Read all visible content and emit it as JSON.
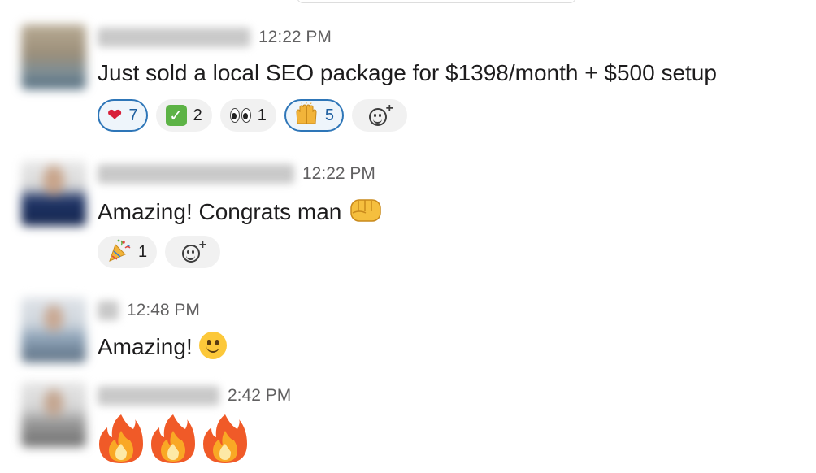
{
  "messages": [
    {
      "time": "12:22 PM",
      "text": "Just sold a local SEO package for $1398/month + $500 setup",
      "reactions": [
        {
          "emoji": "heart",
          "count": "7",
          "active": true
        },
        {
          "emoji": "check-mark",
          "count": "2",
          "active": false
        },
        {
          "emoji": "eyes",
          "count": "1",
          "active": false
        },
        {
          "emoji": "raised-hands",
          "count": "5",
          "active": true
        }
      ]
    },
    {
      "time": "12:22 PM",
      "text": "Amazing! Congrats man",
      "text_emoji": "fist-bump",
      "reactions": [
        {
          "emoji": "party-popper",
          "count": "1",
          "active": false
        }
      ]
    },
    {
      "time": "12:48 PM",
      "text": "Amazing!",
      "text_emoji": "slightly-smiling-face"
    },
    {
      "time": "2:42 PM",
      "text_emojis": [
        "fire",
        "fire",
        "fire"
      ]
    }
  ],
  "icons": {
    "add_reaction": "add-reaction-icon"
  },
  "colors": {
    "active_reaction_border": "#2e76b8",
    "active_reaction_bg": "#eef5fb",
    "reaction_bg": "#f1f1f1",
    "timestamp": "#616061",
    "text": "#1d1c1d"
  }
}
